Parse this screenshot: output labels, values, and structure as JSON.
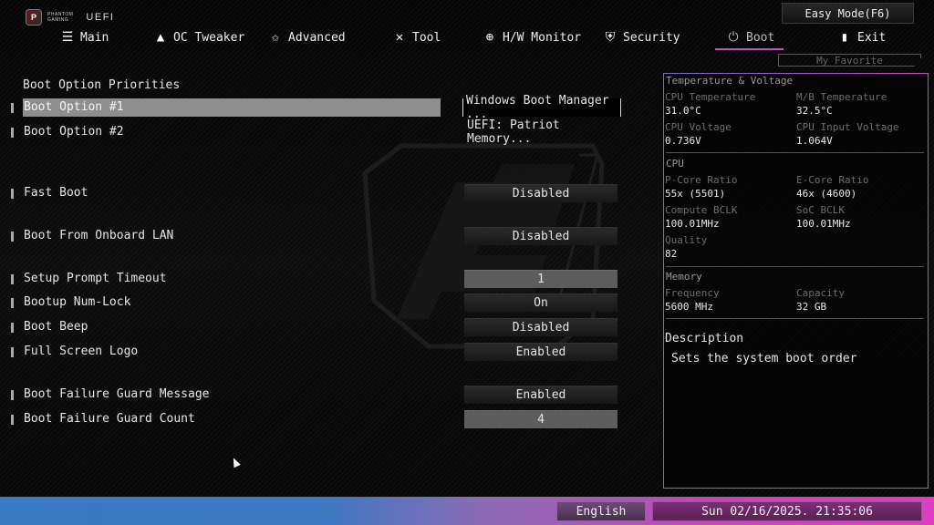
{
  "brand": {
    "line1": "PHANTOM",
    "line2": "GAMING",
    "product": "UEFI"
  },
  "nav": {
    "items": [
      {
        "label": "Main",
        "icon": "list-icon"
      },
      {
        "label": "OC Tweaker",
        "icon": "rocket-icon"
      },
      {
        "label": "Advanced",
        "icon": "star-icon"
      },
      {
        "label": "Tool",
        "icon": "tools-icon"
      },
      {
        "label": "H/W Monitor",
        "icon": "monitor-gauge-icon"
      },
      {
        "label": "Security",
        "icon": "shield-icon"
      },
      {
        "label": "Boot",
        "icon": "power-icon",
        "active": true
      },
      {
        "label": "Exit",
        "icon": "exit-door-icon"
      }
    ],
    "easy_mode": "Easy Mode(F6)",
    "my_favorite": "My Favorite"
  },
  "settings": {
    "section_title": "Boot Option Priorities",
    "rows": [
      {
        "label": "Boot Option #1",
        "value": "Windows Boot Manager ...",
        "selected": true
      },
      {
        "label": "Boot Option #2",
        "value": "UEFI:  Patriot Memory..."
      },
      {
        "label": "Fast Boot",
        "value": "Disabled"
      },
      {
        "label": "Boot From Onboard LAN",
        "value": "Disabled"
      },
      {
        "label": "Setup Prompt Timeout",
        "value": "1"
      },
      {
        "label": "Bootup Num-Lock",
        "value": "On"
      },
      {
        "label": "Boot Beep",
        "value": "Disabled"
      },
      {
        "label": "Full Screen Logo",
        "value": "Enabled"
      },
      {
        "label": "Boot Failure Guard Message",
        "value": "Enabled"
      },
      {
        "label": "Boot Failure Guard Count",
        "value": "4"
      }
    ]
  },
  "monitor": {
    "temp_voltage": {
      "title": "Temperature & Voltage",
      "cpu_temp_label": "CPU Temperature",
      "cpu_temp": "31.0°C",
      "mb_temp_label": "M/B Temperature",
      "mb_temp": "32.5°C",
      "cpu_volt_label": "CPU Voltage",
      "cpu_volt": "0.736V",
      "cpu_in_volt_label": "CPU Input Voltage",
      "cpu_in_volt": "1.064V"
    },
    "cpu": {
      "title": "CPU",
      "pcore_label": "P-Core Ratio",
      "pcore": "55x (5501)",
      "ecore_label": "E-Core Ratio",
      "ecore": "46x (4600)",
      "bclk_label": "Compute BCLK",
      "bclk": "100.01MHz",
      "soc_label": "SoC BCLK",
      "soc": "100.01MHz",
      "quality_label": "Quality",
      "quality": "82"
    },
    "memory": {
      "title": "Memory",
      "freq_label": "Frequency",
      "freq": "5600 MHz",
      "cap_label": "Capacity",
      "cap": "32 GB"
    },
    "description": {
      "title": "Description",
      "text": "Sets the system boot order"
    }
  },
  "footer": {
    "language": "English",
    "datetime": "Sun 02/16/2025. 21:35:06"
  }
}
